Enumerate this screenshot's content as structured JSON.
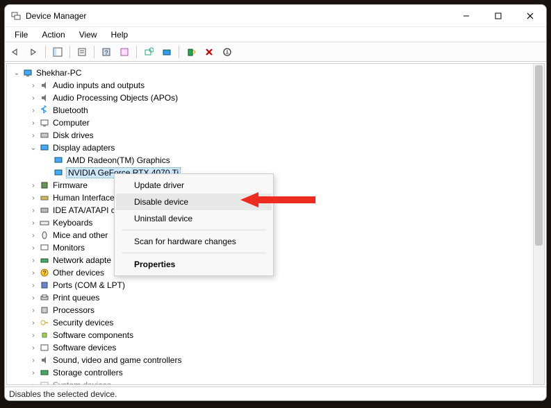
{
  "window": {
    "title": "Device Manager"
  },
  "menubar": {
    "file": "File",
    "action": "Action",
    "view": "View",
    "help": "Help"
  },
  "tree": {
    "root": "Shekhar-PC",
    "items": [
      "Audio inputs and outputs",
      "Audio Processing Objects (APOs)",
      "Bluetooth",
      "Computer",
      "Disk drives",
      "Display adapters",
      "Firmware",
      "Human Interface",
      "IDE ATA/ATAPI c",
      "Keyboards",
      "Mice and other",
      "Monitors",
      "Network adapte",
      "Other devices",
      "Ports (COM & LPT)",
      "Print queues",
      "Processors",
      "Security devices",
      "Software components",
      "Software devices",
      "Sound, video and game controllers",
      "Storage controllers",
      "System devices"
    ],
    "display_children": {
      "amd": "AMD Radeon(TM) Graphics",
      "nvidia": "NVIDIA GeForce RTX 4070 Ti"
    }
  },
  "context_menu": {
    "update_driver": "Update driver",
    "disable_device": "Disable device",
    "uninstall_device": "Uninstall device",
    "scan": "Scan for hardware changes",
    "properties": "Properties"
  },
  "statusbar": {
    "text": "Disables the selected device."
  }
}
